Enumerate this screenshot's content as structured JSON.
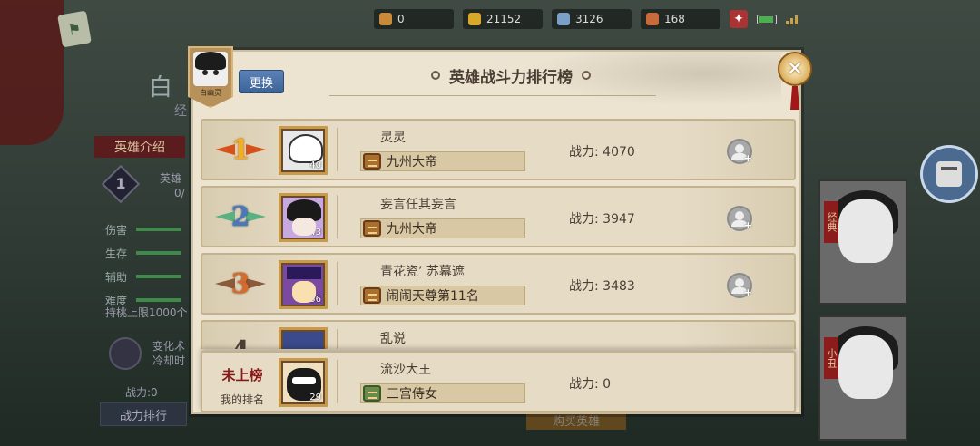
{
  "status_bar": {
    "resources": [
      {
        "icon": "stamina-icon",
        "value": "0",
        "color": "#c98a3a"
      },
      {
        "icon": "gold-icon",
        "value": "21152",
        "color": "#d8a82a"
      },
      {
        "icon": "jade-icon",
        "value": "3126",
        "color": "#7aa0c8"
      },
      {
        "icon": "gate-icon",
        "value": "168",
        "color": "#c86a3a"
      }
    ]
  },
  "background": {
    "hero_name": "白",
    "level_prefix": "经",
    "tab_intro": "英雄介绍",
    "skill_number": "1",
    "skill_name": "英雄",
    "skill_value": "0/",
    "stats": [
      "伤害",
      "生存",
      "辅助",
      "难度"
    ],
    "limit_text": "持桃上限1000个",
    "transform_lines": [
      "变化术",
      "冷却时"
    ],
    "power_label": "战力:0",
    "rank_button": "战力排行",
    "buy_button": "购买英雄",
    "card_tags": [
      "经典",
      "小丑"
    ]
  },
  "modal": {
    "title": "英雄战斗力排行榜",
    "change_button": "更换",
    "avatar_caption": "白幽灵",
    "close_label": "✕",
    "power_prefix": "战力: ",
    "rows": [
      {
        "rank": "1",
        "player": "灵灵",
        "guild": "九州大帝",
        "power": "4070",
        "hero_level": "40",
        "hero_style": "hero-a",
        "rank_style": "r1"
      },
      {
        "rank": "2",
        "player": "妄言任其妄言",
        "guild": "九州大帝",
        "power": "3947",
        "hero_level": "43",
        "hero_style": "hero-b",
        "rank_style": "r2"
      },
      {
        "rank": "3",
        "player": "青花瓷’ 苏幕遮",
        "guild": "闹闹天尊第11名",
        "power": "3483",
        "hero_level": "56",
        "hero_style": "hero-c",
        "rank_style": "r3"
      },
      {
        "rank": "4",
        "player": "乱说",
        "guild": "",
        "power": "",
        "hero_level": "",
        "hero_style": "hero-d",
        "rank_style": "r4"
      }
    ],
    "my_row": {
      "rank_value": "未上榜",
      "rank_label": "我的排名",
      "player": "流沙大王",
      "guild": "三宫侍女",
      "power": "战力: 0",
      "hero_level": "29"
    }
  }
}
